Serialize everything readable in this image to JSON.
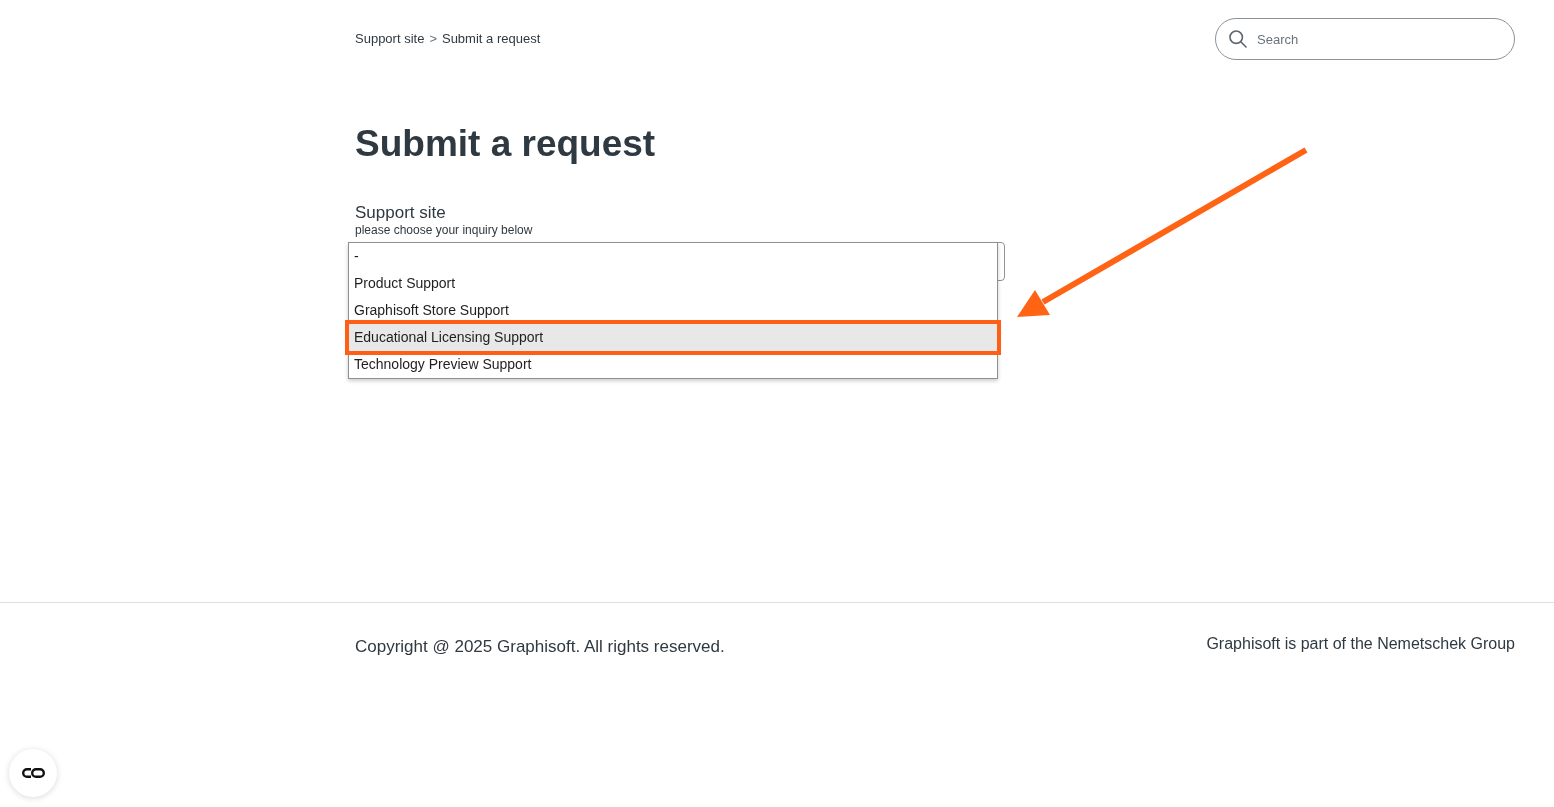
{
  "breadcrumb": {
    "items": [
      {
        "label": "Support site"
      },
      {
        "label": "Submit a request"
      }
    ],
    "separator": ">"
  },
  "search": {
    "placeholder": "Search"
  },
  "title": "Submit a request",
  "field": {
    "label": "Support site",
    "hint": "please choose your inquiry below",
    "expanded": true,
    "options": [
      {
        "label": "-",
        "selected": false,
        "highlighted": false
      },
      {
        "label": "Product Support",
        "selected": false,
        "highlighted": false
      },
      {
        "label": "Graphisoft Store Support",
        "selected": false,
        "highlighted": false
      },
      {
        "label": "Educational Licensing Support",
        "selected": true,
        "highlighted": true
      },
      {
        "label": "Technology Preview Support",
        "selected": false,
        "highlighted": false
      }
    ]
  },
  "footer": {
    "copyright": "Copyright @ 2025 Graphisoft. All rights reserved.",
    "group_note": "Graphisoft is part of the Nemetschek Group"
  }
}
